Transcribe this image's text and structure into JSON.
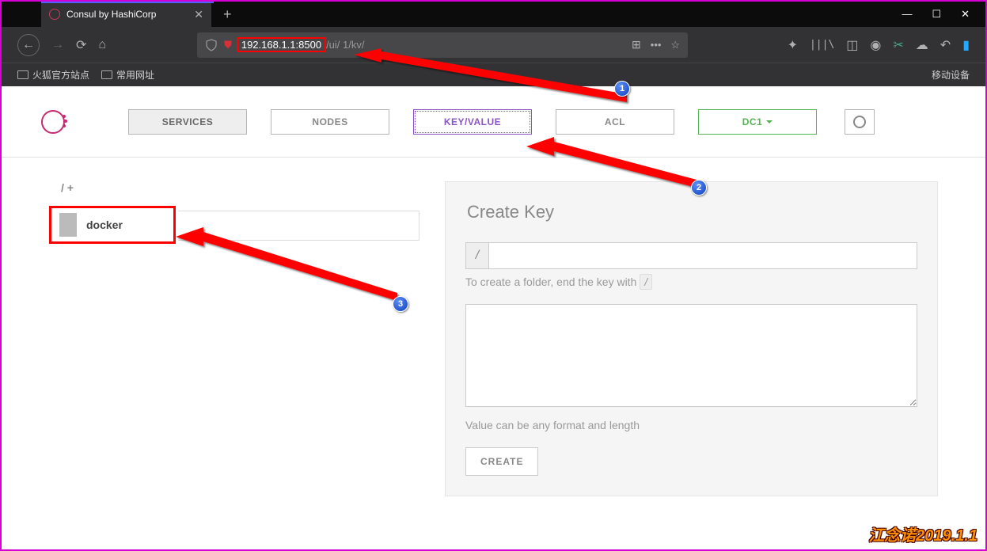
{
  "browser": {
    "tab_title": "Consul by HashiCorp",
    "url_highlight": "192.168.1.1:8500",
    "url_rest": "/ui/           1/kv/",
    "bookmarks": {
      "b1": "火狐官方站点",
      "b2": "常用网址"
    },
    "mobile": "移动设备"
  },
  "nav": {
    "services": "SERVICES",
    "nodes": "NODES",
    "keyvalue": "KEY/VALUE",
    "acl": "ACL",
    "dc": "DC1"
  },
  "kv": {
    "breadcrumb": "/ +",
    "item1": "docker"
  },
  "form": {
    "title": "Create Key",
    "prefix": "/",
    "hint_pre": "To create a folder, end the key with ",
    "hint_code": "/",
    "value_hint": "Value can be any format and length",
    "create": "CREATE"
  },
  "annot": {
    "n1": "1",
    "n2": "2",
    "n3": "3"
  },
  "watermark": "江念诺2019.1.1"
}
